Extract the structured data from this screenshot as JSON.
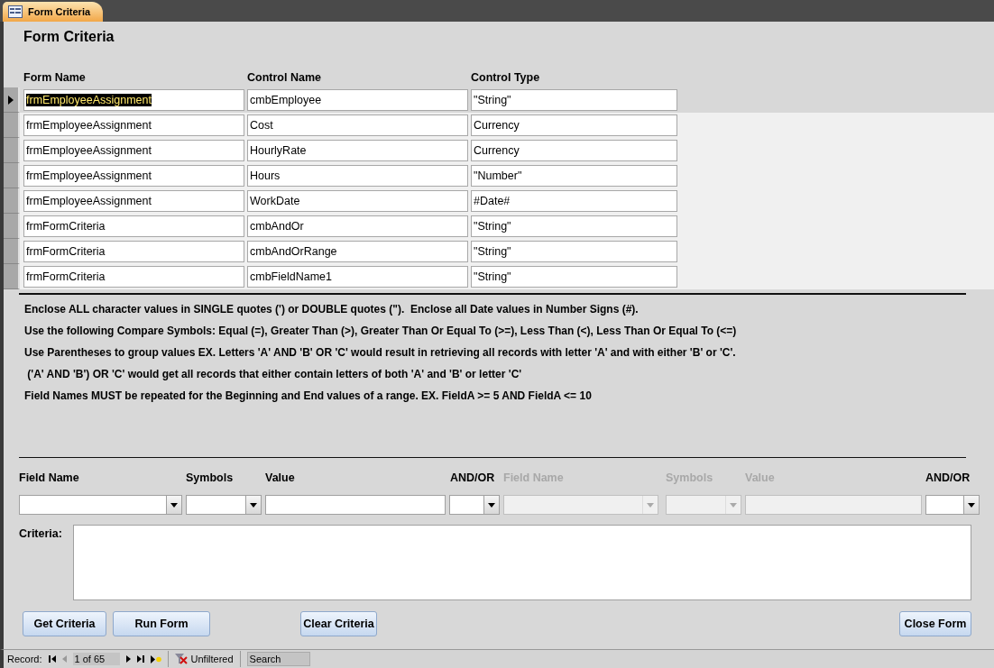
{
  "tab": {
    "title": "Form Criteria"
  },
  "form_title": "Form Criteria",
  "columns": [
    "Form Name",
    "Control Name",
    "Control Type"
  ],
  "rows": [
    {
      "form_name": "frmEmployeeAssignment",
      "control_name": "cmbEmployee",
      "control_type": "\"String\"",
      "selected": true
    },
    {
      "form_name": "frmEmployeeAssignment",
      "control_name": "Cost",
      "control_type": "Currency",
      "selected": false
    },
    {
      "form_name": "frmEmployeeAssignment",
      "control_name": "HourlyRate",
      "control_type": "Currency",
      "selected": false
    },
    {
      "form_name": "frmEmployeeAssignment",
      "control_name": "Hours",
      "control_type": "\"Number\"",
      "selected": false
    },
    {
      "form_name": "frmEmployeeAssignment",
      "control_name": "WorkDate",
      "control_type": "#Date#",
      "selected": false
    },
    {
      "form_name": "frmFormCriteria",
      "control_name": "cmbAndOr",
      "control_type": "\"String\"",
      "selected": false
    },
    {
      "form_name": "frmFormCriteria",
      "control_name": "cmbAndOrRange",
      "control_type": "\"String\"",
      "selected": false
    },
    {
      "form_name": "frmFormCriteria",
      "control_name": "cmbFieldName1",
      "control_type": "\"String\"",
      "selected": false
    }
  ],
  "instructions": [
    "Enclose ALL character values in SINGLE quotes (') or DOUBLE quotes (\").  Enclose all Date values in Number Signs (#).",
    "Use the following Compare Symbols: Equal (=), Greater Than (>), Greater Than Or Equal To (>=), Less Than (<), Less Than Or Equal To (<=)",
    "Use Parentheses to group values EX. Letters 'A' AND 'B' OR 'C' would result in retrieving all records with letter 'A' and with either 'B' or 'C'.",
    " ('A' AND 'B') OR 'C' would get all records that either contain letters of both 'A' and 'B' or letter 'C'",
    "Field Names MUST be repeated for the Beginning and End values of a range. EX. FieldA >= 5 AND FieldA <= 10"
  ],
  "criteria_fields": [
    {
      "label": "Field Name",
      "kind": "combo",
      "disabled": false
    },
    {
      "label": "Symbols",
      "kind": "combo",
      "disabled": false
    },
    {
      "label": "Value",
      "kind": "text",
      "disabled": false
    },
    {
      "label": "AND/OR",
      "kind": "combo",
      "disabled": false
    },
    {
      "label": "Field Name",
      "kind": "combo",
      "disabled": true
    },
    {
      "label": "Symbols",
      "kind": "combo",
      "disabled": true
    },
    {
      "label": "Value",
      "kind": "text",
      "disabled": true
    },
    {
      "label": "AND/OR",
      "kind": "combo",
      "disabled": false
    }
  ],
  "criteria": {
    "label": "Criteria:"
  },
  "buttons": [
    "Get Criteria",
    "Run Form",
    "Clear Criteria",
    "Close Form"
  ],
  "record_nav": {
    "label": "Record:",
    "position": "1 of 65",
    "filter": "Unfiltered",
    "search_placeholder": "Search"
  }
}
